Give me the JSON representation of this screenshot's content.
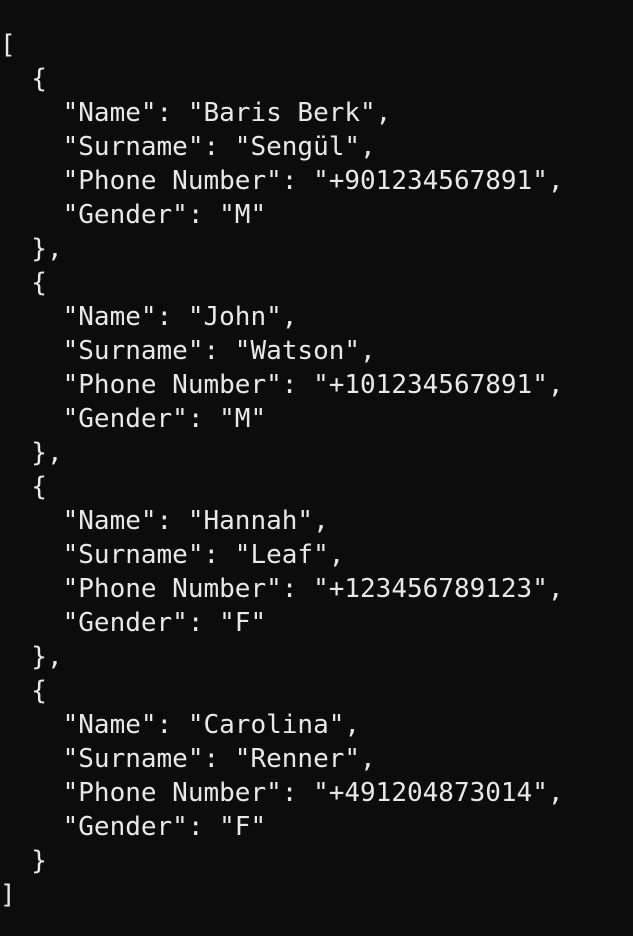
{
  "terminal": {
    "lines": [
      "[",
      "  {",
      "    \"Name\": \"Baris Berk\",",
      "    \"Surname\": \"Sengül\",",
      "    \"Phone Number\": \"+901234567891\",",
      "    \"Gender\": \"M\"",
      "  },",
      "  {",
      "    \"Name\": \"John\",",
      "    \"Surname\": \"Watson\",",
      "    \"Phone Number\": \"+101234567891\",",
      "    \"Gender\": \"M\"",
      "  },",
      "  {",
      "    \"Name\": \"Hannah\",",
      "    \"Surname\": \"Leaf\",",
      "    \"Phone Number\": \"+123456789123\",",
      "    \"Gender\": \"F\"",
      "  },",
      "  {",
      "    \"Name\": \"Carolina\",",
      "    \"Surname\": \"Renner\",",
      "    \"Phone Number\": \"+491204873014\",",
      "    \"Gender\": \"F\"",
      "  }",
      "]"
    ]
  }
}
